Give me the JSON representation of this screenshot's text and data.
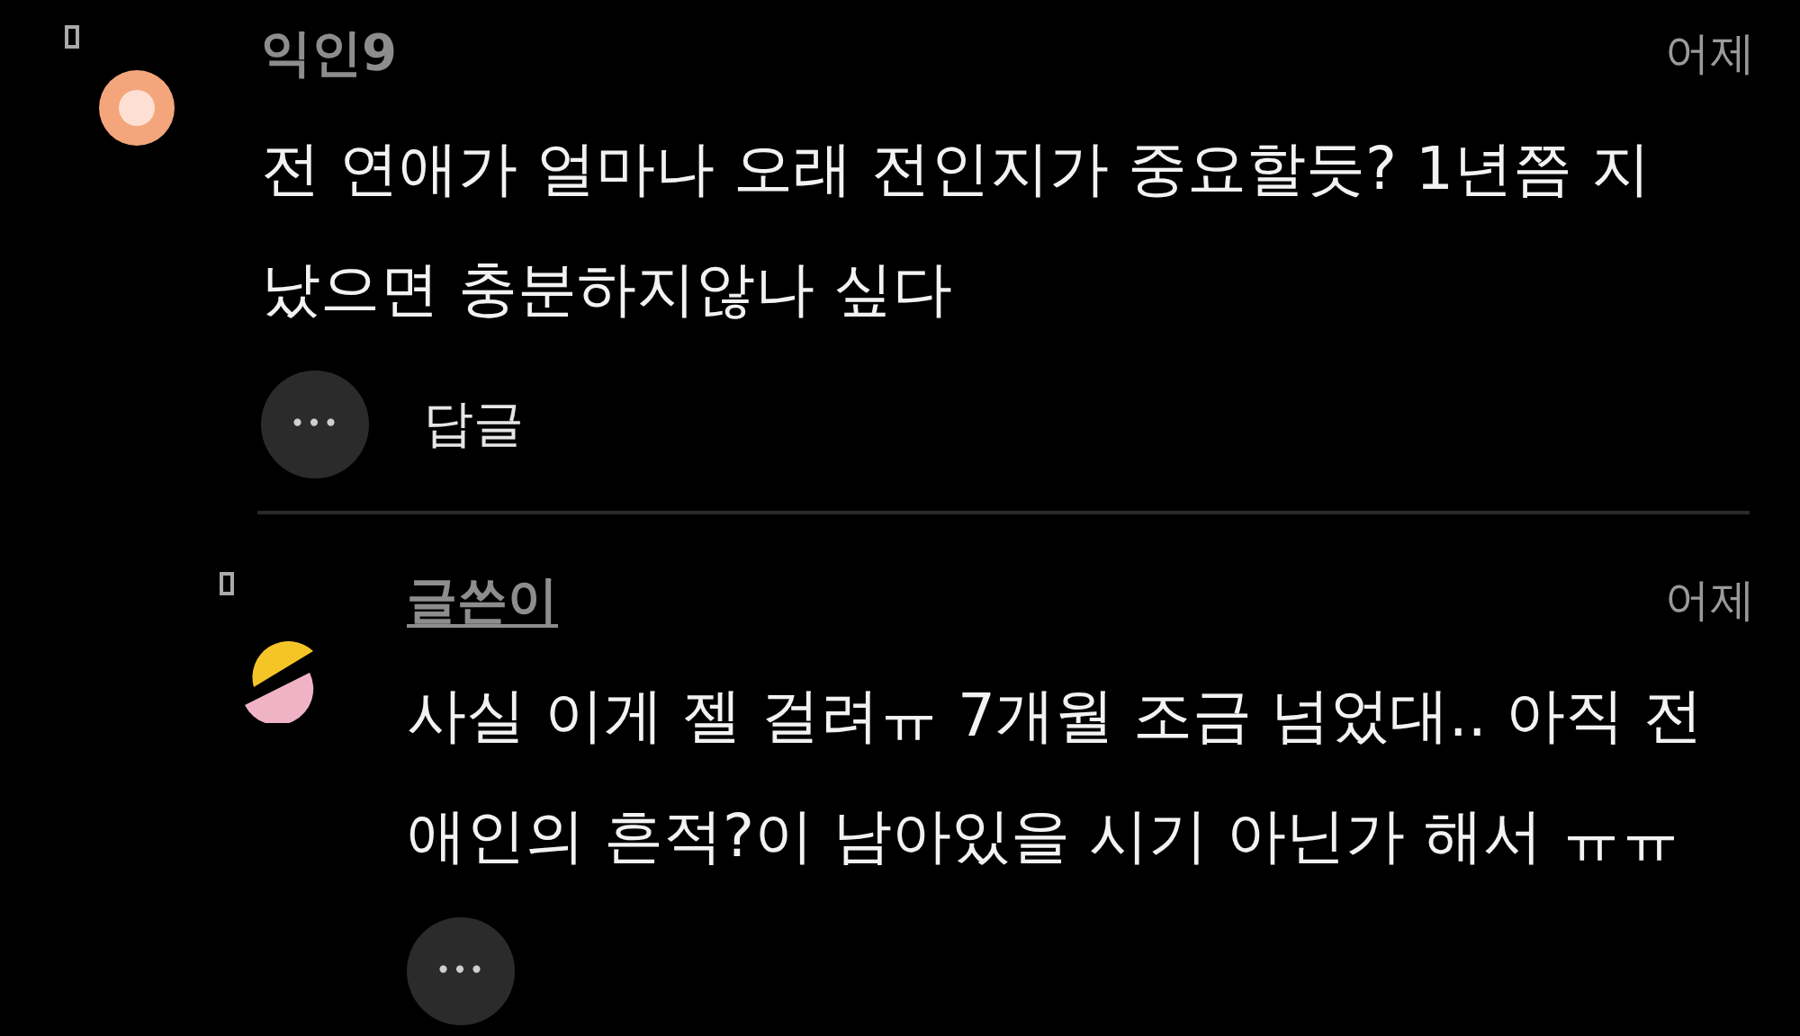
{
  "comments": [
    {
      "author": "익인9",
      "time": "어제",
      "text": "전 연애가 얼마나 오래 전인지가 중요할듯? 1년쯤 지났으면 충분하지않나 싶다",
      "more": "•••",
      "reply": "답글",
      "is_author": false,
      "kind": "ring"
    },
    {
      "author": "글쓴이",
      "time": "어제",
      "text": "사실 이게 젤 걸려ㅠ 7개월 조금 넘었대.. 아직 전애인의 흔적?이 남아있을 시기 아닌가 해서 ㅠㅠ",
      "more": "•••",
      "is_author": true,
      "kind": "split"
    }
  ]
}
